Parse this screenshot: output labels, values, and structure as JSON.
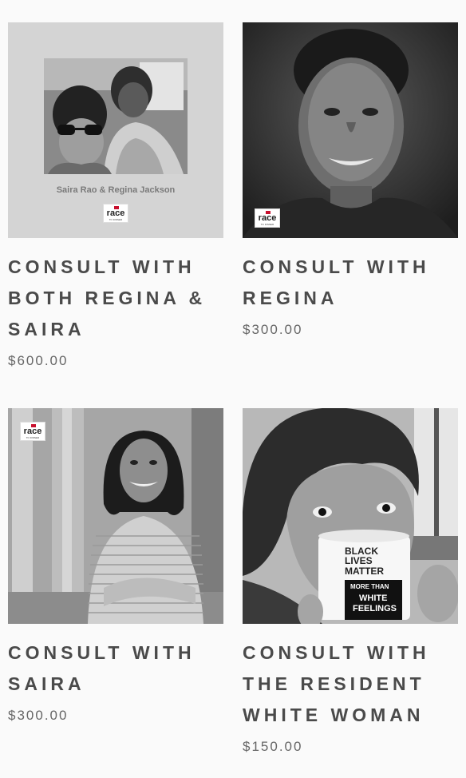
{
  "products": [
    {
      "title_lines": [
        "Consult with",
        "both Regina &",
        "Saira"
      ],
      "price": "$600.00",
      "image": {
        "caption": "Saira Rao & Regina Jackson",
        "logo_text": "race",
        "logo_sub": "TO DINNER"
      }
    },
    {
      "title_lines": [
        "Consult with",
        "Regina"
      ],
      "price": "$300.00",
      "image": {
        "logo_text": "race",
        "logo_sub": "TO DINNER"
      }
    },
    {
      "title_lines": [
        "Consult with",
        "Saira"
      ],
      "price": "$300.00",
      "image": {
        "logo_text": "race",
        "logo_sub": "TO DINNER"
      }
    },
    {
      "title_lines": [
        "Consult with",
        "the resident",
        "white woman"
      ],
      "price": "$150.00",
      "image": {
        "mug_text": [
          "BLACK",
          "LIVES",
          "MATTER",
          "MORE THAN",
          "WHITE",
          "FEELINGS"
        ]
      }
    }
  ],
  "colors": {
    "background": "#fafafa",
    "title": "#4a4a4a",
    "price": "#666666",
    "logo_red": "#c8102e"
  }
}
